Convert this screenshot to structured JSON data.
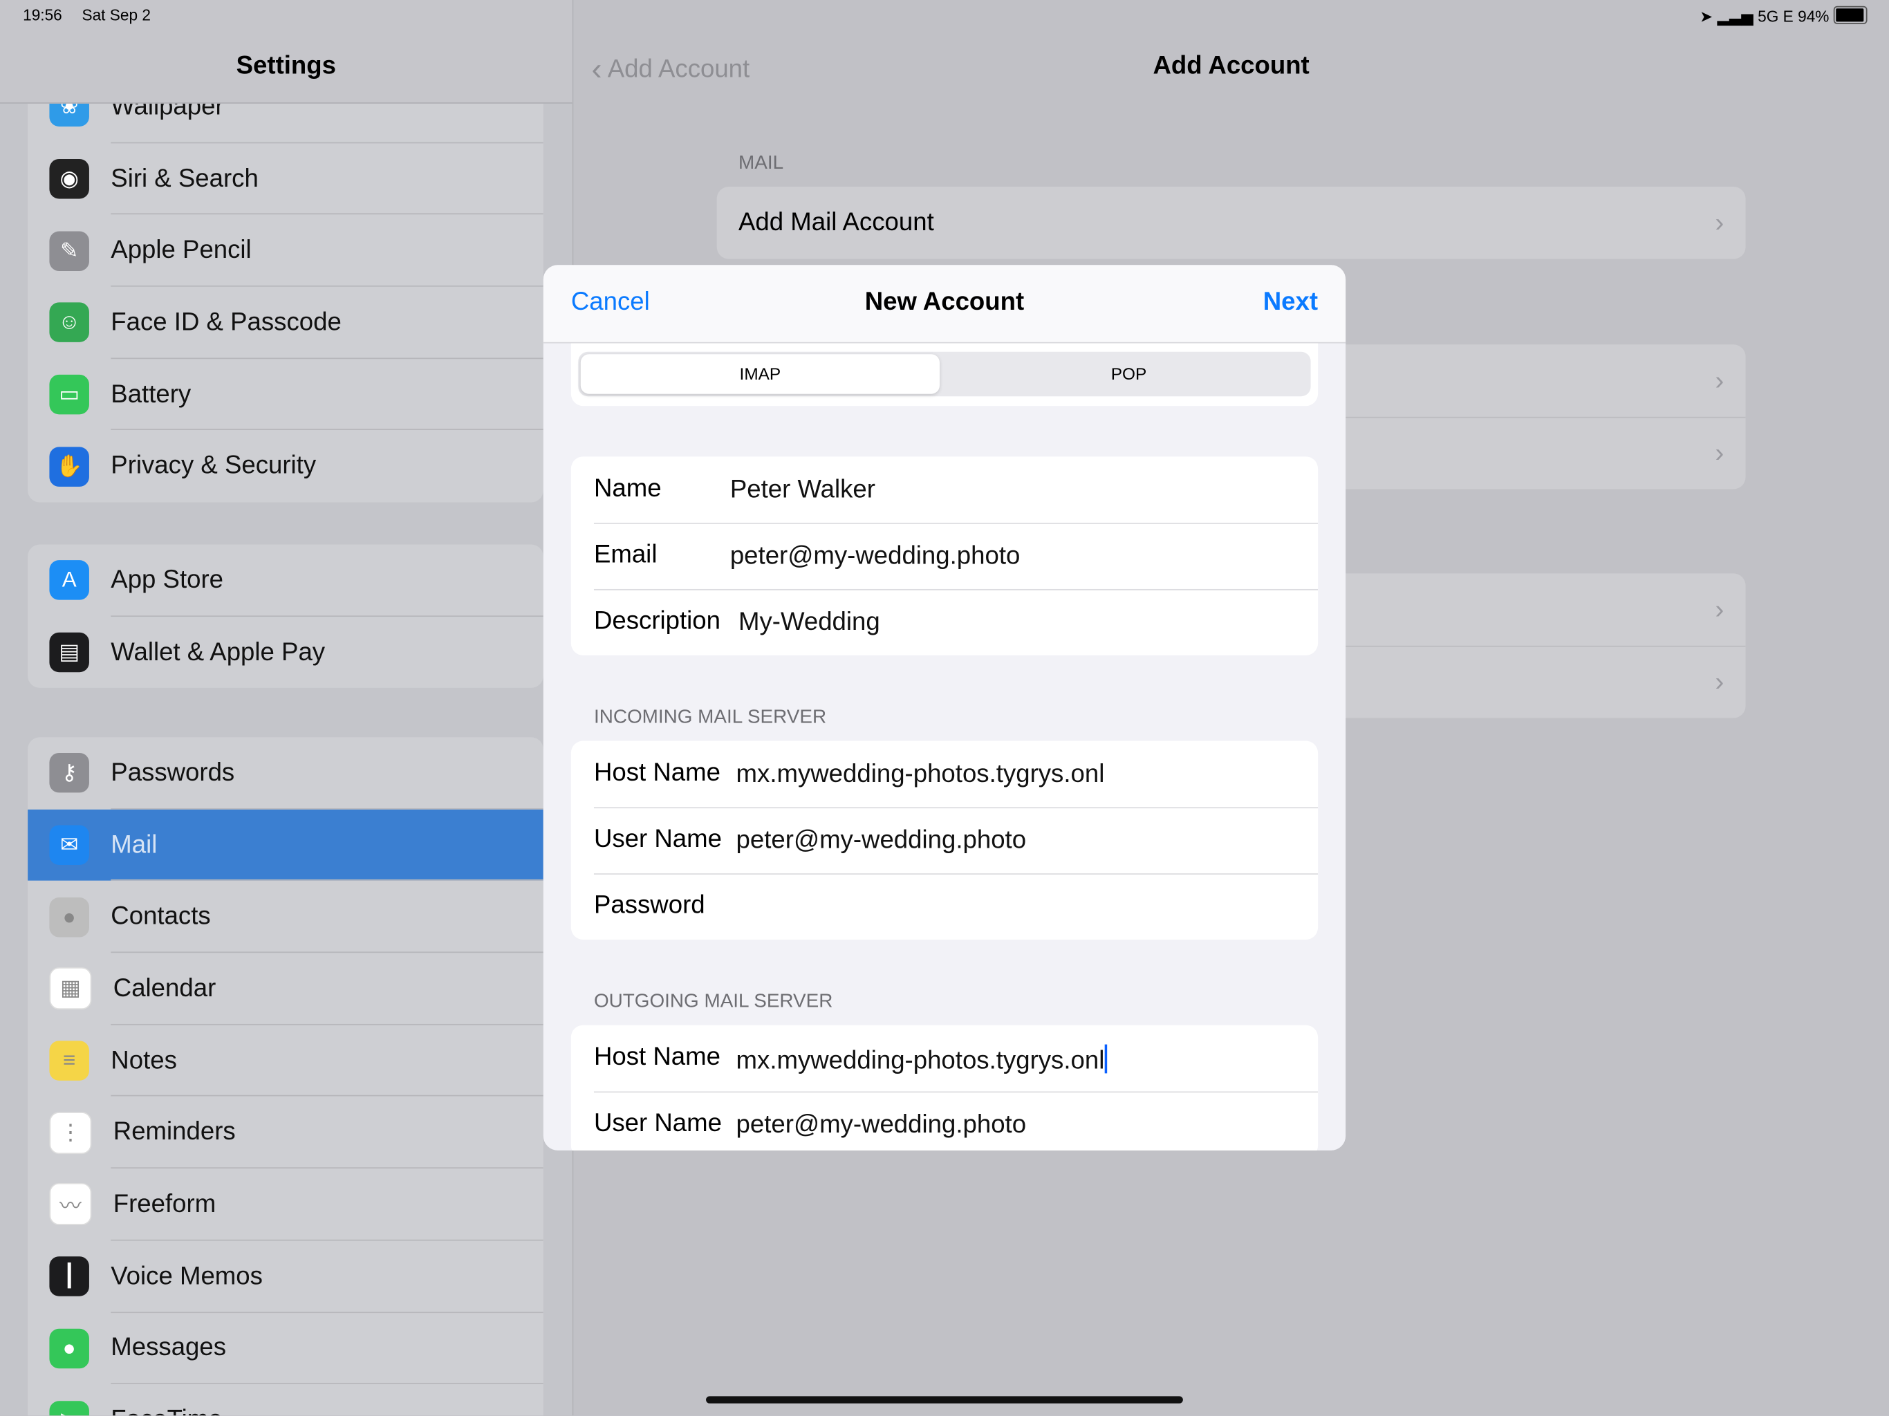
{
  "status": {
    "time": "19:56",
    "date": "Sat Sep 2",
    "network": "5G E",
    "battery": "94%",
    "battery_level": 0.94
  },
  "sidebar": {
    "title": "Settings",
    "groups": [
      [
        {
          "label": "Wallpaper",
          "icon": "flower-icon",
          "color": "#2f9be8"
        },
        {
          "label": "Siri & Search",
          "icon": "siri-icon",
          "color": "#222"
        },
        {
          "label": "Apple Pencil",
          "icon": "pencil-icon",
          "color": "#8e8e93"
        },
        {
          "label": "Face ID & Passcode",
          "icon": "faceid-icon",
          "color": "#34a853"
        },
        {
          "label": "Battery",
          "icon": "battery-icon",
          "color": "#34c759"
        },
        {
          "label": "Privacy & Security",
          "icon": "hand-icon",
          "color": "#1f6fe0"
        }
      ],
      [
        {
          "label": "App Store",
          "icon": "appstore-icon",
          "color": "#1c8ef5"
        },
        {
          "label": "Wallet & Apple Pay",
          "icon": "wallet-icon",
          "color": "#1c1c1e"
        }
      ],
      [
        {
          "label": "Passwords",
          "icon": "key-icon",
          "color": "#8e8e93"
        },
        {
          "label": "Mail",
          "icon": "envelope-icon",
          "color": "#1e86f0",
          "selected": true
        },
        {
          "label": "Contacts",
          "icon": "contacts-icon",
          "color": "#bdbdbd"
        },
        {
          "label": "Calendar",
          "icon": "calendar-icon",
          "color": "#fff"
        },
        {
          "label": "Notes",
          "icon": "notes-icon",
          "color": "#f5d547"
        },
        {
          "label": "Reminders",
          "icon": "reminders-icon",
          "color": "#fff"
        },
        {
          "label": "Freeform",
          "icon": "freeform-icon",
          "color": "#fff"
        },
        {
          "label": "Voice Memos",
          "icon": "waveform-icon",
          "color": "#1c1c1e"
        },
        {
          "label": "Messages",
          "icon": "message-icon",
          "color": "#34c759"
        },
        {
          "label": "FaceTime",
          "icon": "video-icon",
          "color": "#34c759"
        }
      ]
    ]
  },
  "detail": {
    "back_label": "Add Account",
    "title": "Add Account",
    "section": "MAIL",
    "add_mail": "Add Mail Account"
  },
  "modal": {
    "cancel": "Cancel",
    "title": "New Account",
    "next": "Next",
    "segments": [
      "IMAP",
      "POP"
    ],
    "selected_segment": "IMAP",
    "account": {
      "name_label": "Name",
      "name": "Peter Walker",
      "email_label": "Email",
      "email": "peter@my-wedding.photo",
      "desc_label": "Description",
      "desc": "My-Wedding"
    },
    "incoming": {
      "header": "INCOMING MAIL SERVER",
      "host_label": "Host Name",
      "host": "mx.mywedding-photos.tygrys.onl",
      "user_label": "User Name",
      "user": "peter@my-wedding.photo",
      "pass_label": "Password"
    },
    "outgoing": {
      "header": "OUTGOING MAIL SERVER",
      "host_label": "Host Name",
      "host": "mx.mywedding-photos.tygrys.onl",
      "user_label": "User Name",
      "user": "peter@my-wedding.photo"
    }
  }
}
